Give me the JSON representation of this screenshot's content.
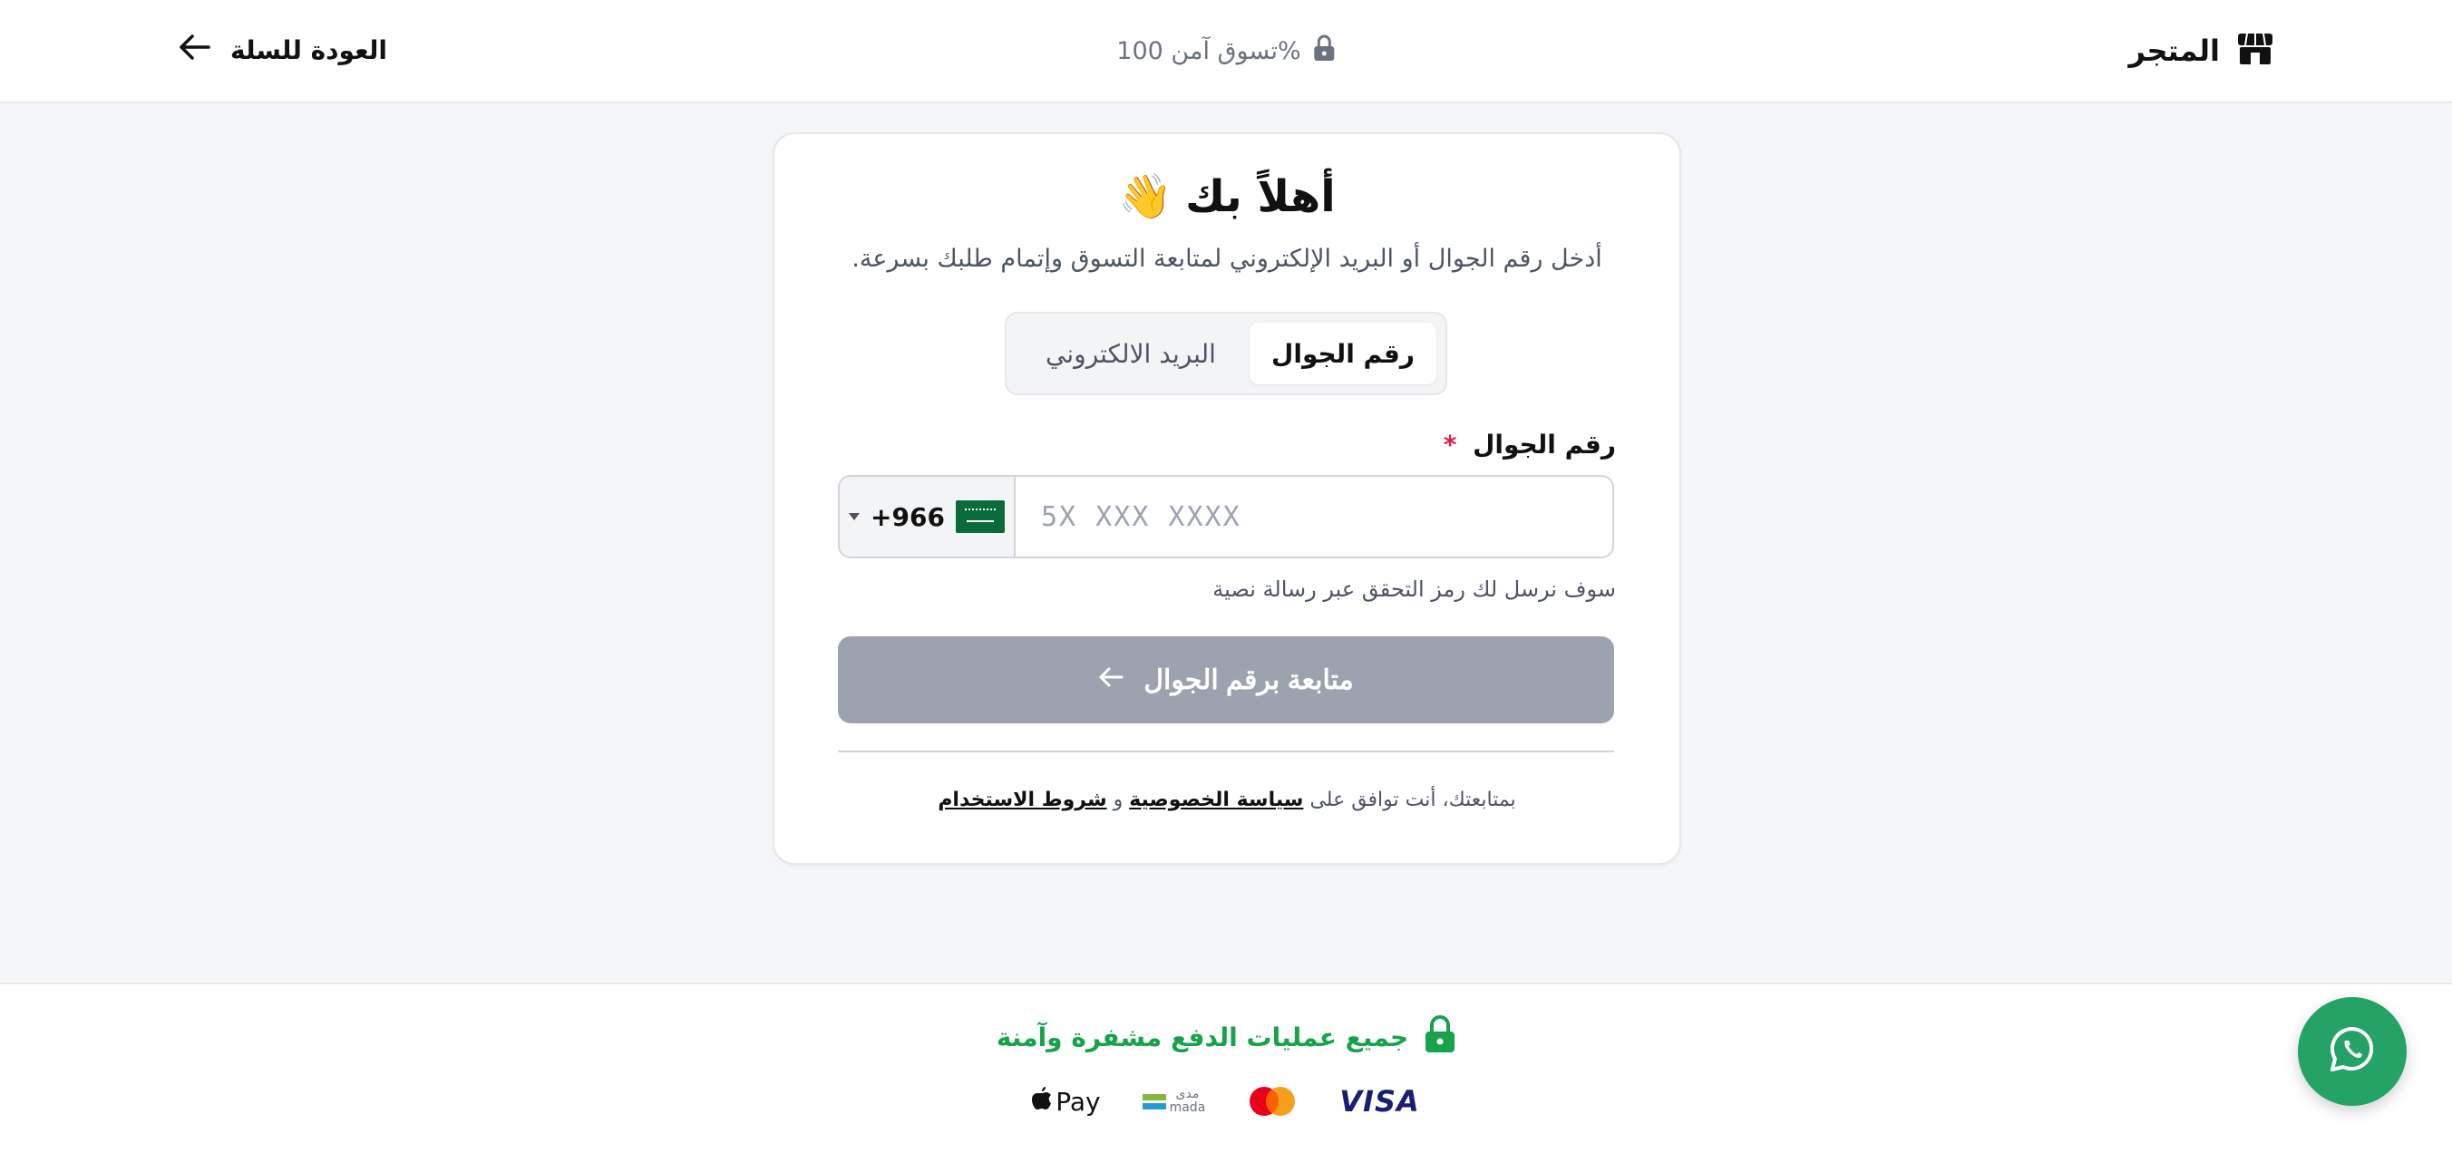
{
  "header": {
    "brand_name": "المتجر",
    "secure_text": "تسوق آمن 100%",
    "back_label": "العودة للسلة"
  },
  "card": {
    "title": "أهلاً بك",
    "title_emoji": "👋",
    "subtitle": "أدخل رقم الجوال أو البريد الإلكتروني لمتابعة التسوق وإتمام طلبك بسرعة.",
    "tabs": [
      {
        "label": "رقم الجوال",
        "active": true
      },
      {
        "label": "البريد الالكتروني",
        "active": false
      }
    ],
    "phone_field": {
      "label": "رقم الجوال",
      "required_mark": "*",
      "country_code": "+966",
      "placeholder": "5X XXX XXXX",
      "value": ""
    },
    "hint": "سوف نرسل لك رمز التحقق عبر رسالة نصية",
    "submit_label": "متابعة برقم الجوال",
    "terms": {
      "prefix": "بمتابعتك، أنت توافق على",
      "privacy_link": "سياسة الخصوصية",
      "conjunction": "و",
      "terms_link": "شروط الاستخدام"
    }
  },
  "footer": {
    "secure_text": "جميع عمليات الدفع مشفرة وآمنة",
    "payment_methods": [
      {
        "name": "visa",
        "label": "VISA"
      },
      {
        "name": "mastercard"
      },
      {
        "name": "mada",
        "label_ar": "مدى",
        "label_en": "mada"
      },
      {
        "name": "apple-pay",
        "label": "Pay"
      }
    ]
  },
  "colors": {
    "accent_green": "#16a34a",
    "whatsapp_green": "#25a366",
    "button_disabled": "#9ca3af",
    "required_red": "#e11d48"
  }
}
